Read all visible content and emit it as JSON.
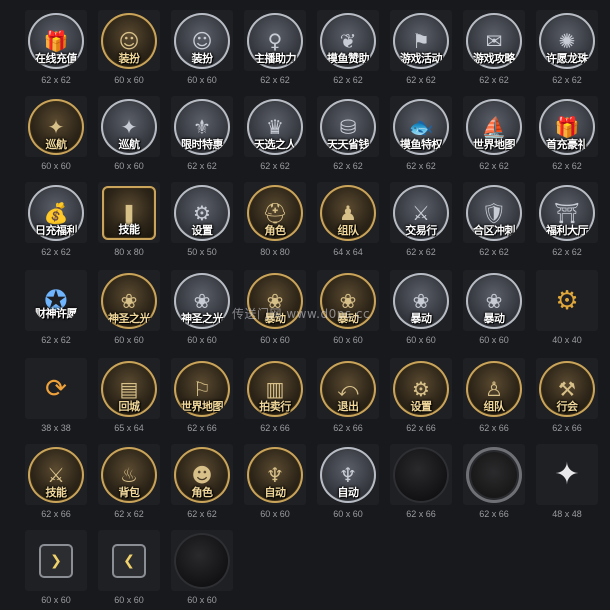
{
  "watermark": "传送门网 www.d0ps.cc",
  "rows": [
    [
      {
        "name": "recharge-icon",
        "label": "在线充值",
        "size": "62 x 62",
        "style": "silver",
        "glyph": "🎁"
      },
      {
        "name": "dress-up-icon",
        "label": "装扮",
        "size": "60 x 60",
        "style": "gold",
        "glyph": "☺"
      },
      {
        "name": "dress-up-gray-icon",
        "label": "装扮",
        "size": "60 x 60",
        "style": "silver",
        "glyph": "☺"
      },
      {
        "name": "streamer-help-icon",
        "label": "主播助力",
        "size": "62 x 62",
        "style": "silver",
        "glyph": "♀"
      },
      {
        "name": "fishing-sponsor-icon",
        "label": "摸鱼赞助",
        "size": "62 x 62",
        "style": "silver",
        "glyph": "❦"
      },
      {
        "name": "game-event-icon",
        "label": "游戏活动",
        "size": "62 x 62",
        "style": "silver",
        "glyph": "⚑"
      },
      {
        "name": "game-guide-icon",
        "label": "游戏攻略",
        "size": "62 x 62",
        "style": "silver",
        "glyph": "✉"
      },
      {
        "name": "wish-dragon-pearl-icon",
        "label": "许愿龙珠",
        "size": "62 x 62",
        "style": "silver",
        "glyph": "✺"
      }
    ],
    [
      {
        "name": "cruise-icon",
        "label": "巡航",
        "size": "60 x 60",
        "style": "gold",
        "glyph": "✦"
      },
      {
        "name": "cruise-gray-icon",
        "label": "巡航",
        "size": "60 x 60",
        "style": "silver",
        "glyph": "✦"
      },
      {
        "name": "limited-offer-icon",
        "label": "限时特惠",
        "size": "62 x 62",
        "style": "silver",
        "glyph": "⚜"
      },
      {
        "name": "chosen-one-icon",
        "label": "天选之人",
        "size": "62 x 62",
        "style": "silver",
        "glyph": "♛"
      },
      {
        "name": "daily-saving-icon",
        "label": "天天省钱",
        "size": "62 x 62",
        "style": "silver",
        "glyph": "⛁"
      },
      {
        "name": "fishing-privilege-icon",
        "label": "摸鱼特权",
        "size": "62 x 62",
        "style": "silver",
        "glyph": "🐟"
      },
      {
        "name": "world-map-ship-icon",
        "label": "世界地图",
        "size": "62 x 62",
        "style": "silver",
        "glyph": "⛵"
      },
      {
        "name": "first-charge-gift-icon",
        "label": "首充豪礼",
        "size": "62 x 62",
        "style": "silver",
        "glyph": "🎁"
      }
    ],
    [
      {
        "name": "daily-charge-welfare-icon",
        "label": "日充福利",
        "size": "62 x 62",
        "style": "silver",
        "glyph": "💰"
      },
      {
        "name": "skill-icon",
        "label": "技能",
        "size": "80 x 80",
        "style": "square",
        "glyph": "❚"
      },
      {
        "name": "settings-icon",
        "label": "设置",
        "size": "50 x 50",
        "style": "silver",
        "glyph": "⚙"
      },
      {
        "name": "character-icon",
        "label": "角色",
        "size": "80 x 80",
        "style": "gold",
        "glyph": "⛑"
      },
      {
        "name": "team-icon",
        "label": "组队",
        "size": "64 x 64",
        "style": "gold",
        "glyph": "♟"
      },
      {
        "name": "trade-icon",
        "label": "交易行",
        "size": "62 x 62",
        "style": "silver",
        "glyph": "⚔"
      },
      {
        "name": "merge-server-icon",
        "label": "合区冲刺",
        "size": "62 x 62",
        "style": "silver",
        "glyph": "🛡"
      },
      {
        "name": "welfare-hall-icon",
        "label": "福利大厅",
        "size": "62 x 62",
        "style": "silver",
        "glyph": "⛩"
      }
    ],
    [
      {
        "name": "god-of-wealth-wish-icon",
        "label": "财神许愿",
        "size": "62 x 62",
        "style": "plain",
        "glyph": "✪"
      },
      {
        "name": "holy-light-icon",
        "label": "神圣之光",
        "size": "60 x 60",
        "style": "gold",
        "glyph": "❀"
      },
      {
        "name": "holy-light-gray-icon",
        "label": "神圣之光",
        "size": "60 x 60",
        "style": "silver",
        "glyph": "❀"
      },
      {
        "name": "blood-rage-icon",
        "label": "暴动",
        "size": "60 x 60",
        "style": "gold",
        "glyph": "❀"
      },
      {
        "name": "crit-rage-icon",
        "label": "暴动",
        "size": "60 x 60",
        "style": "gold",
        "glyph": "❀"
      },
      {
        "name": "crit-rage-gray-icon",
        "label": "暴动",
        "size": "60 x 60",
        "style": "silver",
        "glyph": "❀"
      },
      {
        "name": "rage-gray-icon",
        "label": "暴动",
        "size": "60 x 60",
        "style": "silver",
        "glyph": "❀"
      },
      {
        "name": "small-gear-icon",
        "label": "",
        "size": "40 x 40",
        "style": "plain",
        "glyph": "⚙"
      }
    ],
    [
      {
        "name": "refresh-icon",
        "label": "",
        "size": "38 x 38",
        "style": "plain",
        "glyph": "⟳"
      },
      {
        "name": "return-city-icon",
        "label": "回城",
        "size": "65 x 64",
        "style": "gold",
        "glyph": "▤"
      },
      {
        "name": "world-map-icon",
        "label": "世界地图",
        "size": "62 x 66",
        "style": "gold",
        "glyph": "⚐"
      },
      {
        "name": "auction-icon",
        "label": "拍卖行",
        "size": "62 x 66",
        "style": "gold",
        "glyph": "▥"
      },
      {
        "name": "exit-icon",
        "label": "退出",
        "size": "62 x 66",
        "style": "gold",
        "glyph": "⤺"
      },
      {
        "name": "settings-gear-icon",
        "label": "设置",
        "size": "62 x 66",
        "style": "gold",
        "glyph": "⚙"
      },
      {
        "name": "team-portrait-icon",
        "label": "组队",
        "size": "62 x 66",
        "style": "gold",
        "glyph": "♙"
      },
      {
        "name": "guild-icon",
        "label": "行会",
        "size": "62 x 66",
        "style": "gold",
        "glyph": "⚒"
      }
    ],
    [
      {
        "name": "skills-icon",
        "label": "技能",
        "size": "62 x 66",
        "style": "gold",
        "glyph": "⚔"
      },
      {
        "name": "backpack-icon",
        "label": "背包",
        "size": "62 x 62",
        "style": "gold",
        "glyph": "♨"
      },
      {
        "name": "hero-portrait-icon",
        "label": "角色",
        "size": "62 x 62",
        "style": "gold",
        "glyph": "☻"
      },
      {
        "name": "auto-icon",
        "label": "自动",
        "size": "60 x 60",
        "style": "gold",
        "glyph": "♆"
      },
      {
        "name": "auto-gray-icon",
        "label": "自动",
        "size": "60 x 60",
        "style": "silver",
        "glyph": "♆"
      },
      {
        "name": "empty-round-slot-icon",
        "label": "",
        "size": "62 x 66",
        "style": "silver-black",
        "glyph": ""
      },
      {
        "name": "stone-round-slot-icon",
        "label": "",
        "size": "62 x 66",
        "style": "stone",
        "glyph": ""
      },
      {
        "name": "shuriken-icon",
        "label": "",
        "size": "48 x 48",
        "style": "plain",
        "glyph": "✦"
      }
    ],
    [
      {
        "name": "arrow-right-icon",
        "label": "",
        "size": "60 x 60",
        "style": "square-small",
        "glyph": "❯"
      },
      {
        "name": "arrow-left-icon",
        "label": "",
        "size": "60 x 60",
        "style": "square-small",
        "glyph": "❮"
      },
      {
        "name": "black-circle-icon",
        "label": "",
        "size": "60 x 60",
        "style": "black",
        "glyph": ""
      }
    ]
  ]
}
